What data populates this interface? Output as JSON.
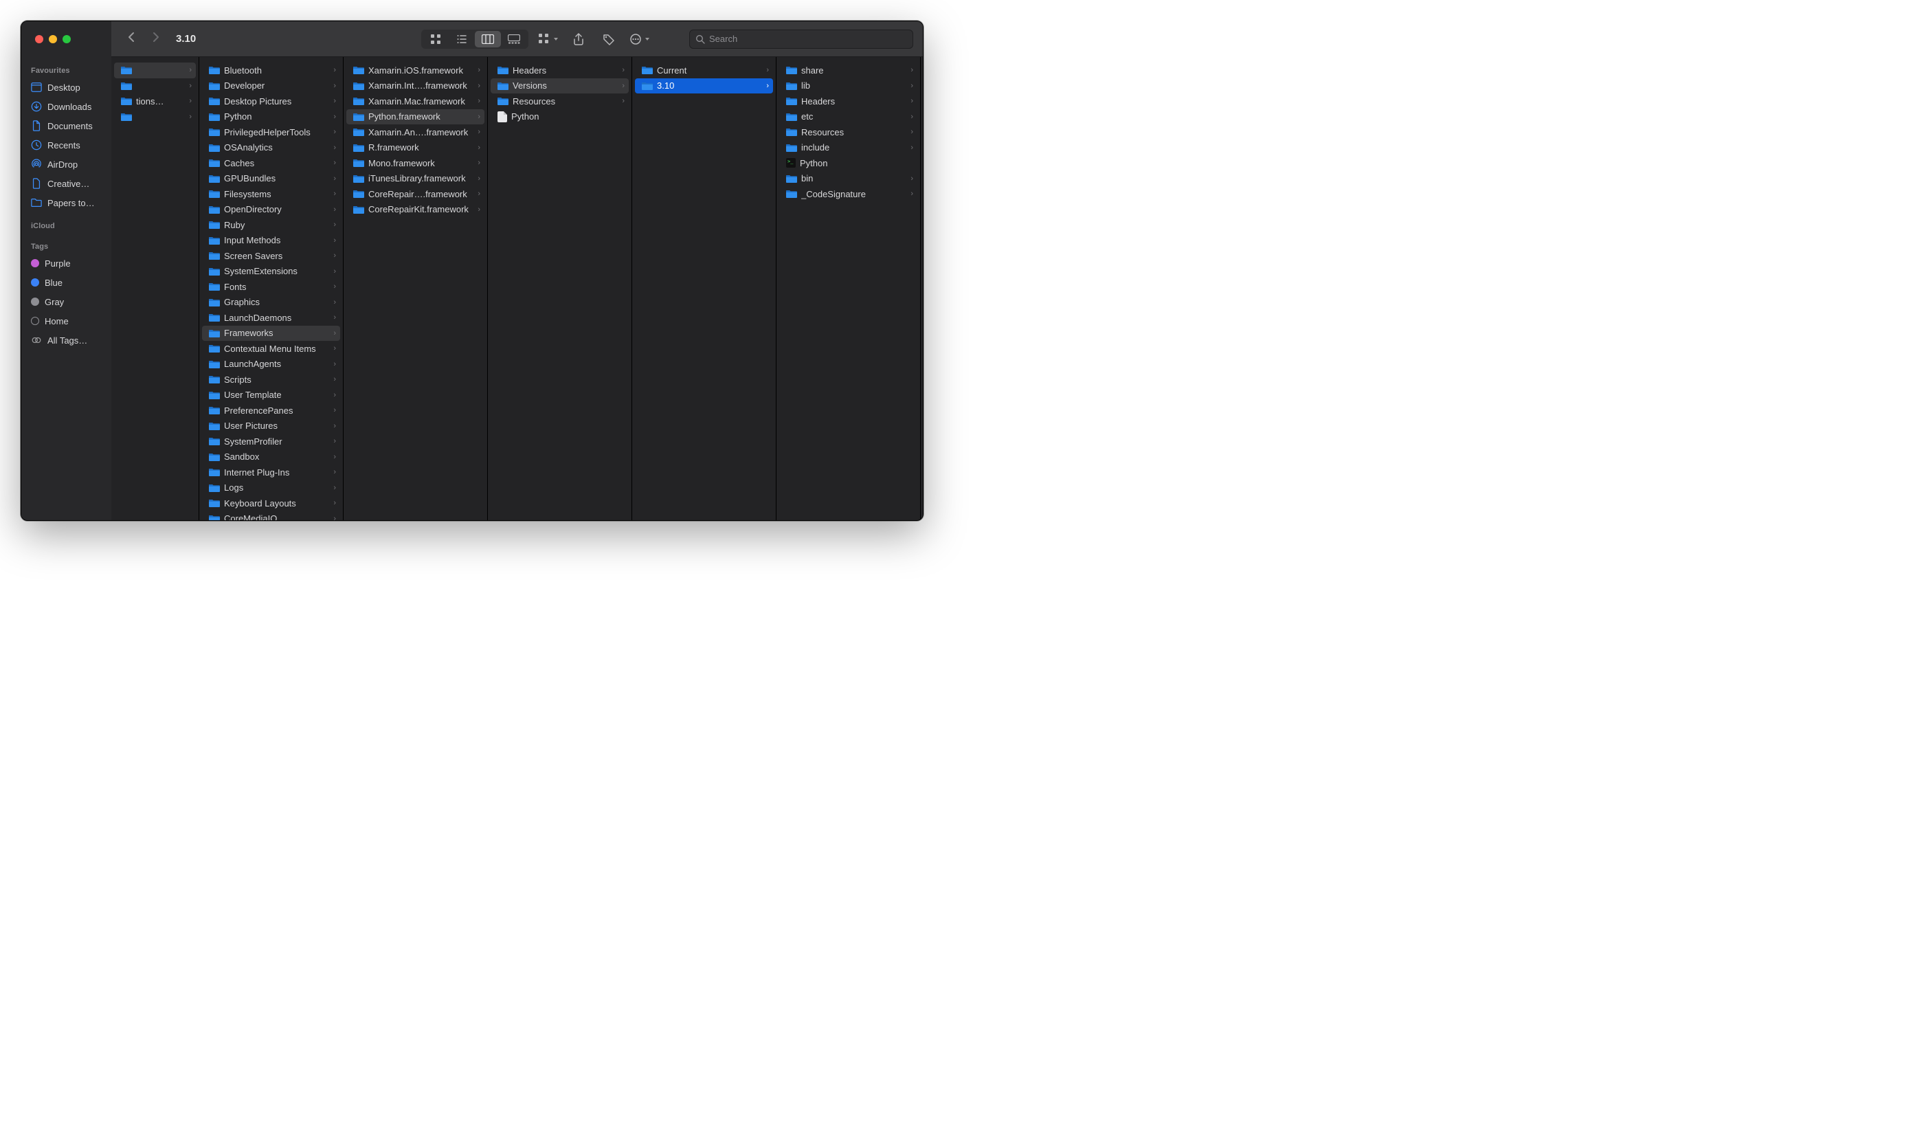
{
  "window_title": "3.10",
  "search_placeholder": "Search",
  "sidebar": {
    "sections": [
      {
        "label": "Favourites",
        "items": [
          {
            "icon": "desktop",
            "label": "Desktop"
          },
          {
            "icon": "downloads",
            "label": "Downloads"
          },
          {
            "icon": "documents",
            "label": "Documents"
          },
          {
            "icon": "recents",
            "label": "Recents"
          },
          {
            "icon": "airdrop",
            "label": "AirDrop"
          },
          {
            "icon": "file",
            "label": "Creative…"
          },
          {
            "icon": "folder",
            "label": "Papers to…"
          }
        ]
      },
      {
        "label": "iCloud",
        "items": []
      },
      {
        "label": "Tags",
        "items": [
          {
            "dot": "#c45fd5",
            "label": "Purple"
          },
          {
            "dot": "#3b82f6",
            "label": "Blue"
          },
          {
            "dot": "#8e8e93",
            "label": "Gray"
          },
          {
            "dot_outline": "#8e8e93",
            "label": "Home"
          },
          {
            "icon": "alltags",
            "label": "All Tags…"
          }
        ]
      }
    ]
  },
  "columns": [
    {
      "items": [
        {
          "name": "",
          "kind": "folder",
          "sel": true
        },
        {
          "name": "",
          "kind": "folder"
        },
        {
          "name": "…tions",
          "kind": "folder",
          "truncated_left": true
        },
        {
          "name": "",
          "kind": "folder"
        }
      ]
    },
    {
      "items": [
        {
          "name": "Bluetooth",
          "kind": "folder"
        },
        {
          "name": "Developer",
          "kind": "folder"
        },
        {
          "name": "Desktop Pictures",
          "kind": "folder"
        },
        {
          "name": "Python",
          "kind": "folder"
        },
        {
          "name": "PrivilegedHelperTools",
          "kind": "folder"
        },
        {
          "name": "OSAnalytics",
          "kind": "folder"
        },
        {
          "name": "Caches",
          "kind": "folder"
        },
        {
          "name": "GPUBundles",
          "kind": "folder"
        },
        {
          "name": "Filesystems",
          "kind": "folder"
        },
        {
          "name": "OpenDirectory",
          "kind": "folder"
        },
        {
          "name": "Ruby",
          "kind": "folder"
        },
        {
          "name": "Input Methods",
          "kind": "folder"
        },
        {
          "name": "Screen Savers",
          "kind": "folder"
        },
        {
          "name": "SystemExtensions",
          "kind": "folder"
        },
        {
          "name": "Fonts",
          "kind": "folder"
        },
        {
          "name": "Graphics",
          "kind": "folder"
        },
        {
          "name": "LaunchDaemons",
          "kind": "folder"
        },
        {
          "name": "Frameworks",
          "kind": "folder",
          "sel": true
        },
        {
          "name": "Contextual Menu Items",
          "kind": "folder"
        },
        {
          "name": "LaunchAgents",
          "kind": "folder"
        },
        {
          "name": "Scripts",
          "kind": "folder"
        },
        {
          "name": "User Template",
          "kind": "folder"
        },
        {
          "name": "PreferencePanes",
          "kind": "folder"
        },
        {
          "name": "User Pictures",
          "kind": "folder"
        },
        {
          "name": "SystemProfiler",
          "kind": "folder"
        },
        {
          "name": "Sandbox",
          "kind": "folder"
        },
        {
          "name": "Internet Plug-Ins",
          "kind": "folder"
        },
        {
          "name": "Logs",
          "kind": "folder"
        },
        {
          "name": "Keyboard Layouts",
          "kind": "folder"
        },
        {
          "name": "CoreMediaIO",
          "kind": "folder"
        }
      ]
    },
    {
      "items": [
        {
          "name": "Xamarin.iOS.framework",
          "kind": "folder"
        },
        {
          "name": "Xamarin.Int….framework",
          "kind": "folder"
        },
        {
          "name": "Xamarin.Mac.framework",
          "kind": "folder"
        },
        {
          "name": "Python.framework",
          "kind": "folder",
          "sel": true
        },
        {
          "name": "Xamarin.An….framework",
          "kind": "folder"
        },
        {
          "name": "R.framework",
          "kind": "folder"
        },
        {
          "name": "Mono.framework",
          "kind": "folder"
        },
        {
          "name": "iTunesLibrary.framework",
          "kind": "folder"
        },
        {
          "name": "CoreRepair….framework",
          "kind": "folder"
        },
        {
          "name": "CoreRepairKit.framework",
          "kind": "folder"
        }
      ]
    },
    {
      "items": [
        {
          "name": "Headers",
          "kind": "folder"
        },
        {
          "name": "Versions",
          "kind": "folder",
          "sel": true
        },
        {
          "name": "Resources",
          "kind": "folder"
        },
        {
          "name": "Python",
          "kind": "file",
          "no_chev": true
        }
      ]
    },
    {
      "items": [
        {
          "name": "Current",
          "kind": "folder"
        },
        {
          "name": "3.10",
          "kind": "folder",
          "active": true
        }
      ]
    },
    {
      "items": [
        {
          "name": "share",
          "kind": "folder"
        },
        {
          "name": "lib",
          "kind": "folder"
        },
        {
          "name": "Headers",
          "kind": "folder"
        },
        {
          "name": "etc",
          "kind": "folder"
        },
        {
          "name": "Resources",
          "kind": "folder"
        },
        {
          "name": "include",
          "kind": "folder"
        },
        {
          "name": "Python",
          "kind": "exec",
          "no_chev": true
        },
        {
          "name": "bin",
          "kind": "folder"
        },
        {
          "name": "_CodeSignature",
          "kind": "folder"
        }
      ]
    }
  ]
}
